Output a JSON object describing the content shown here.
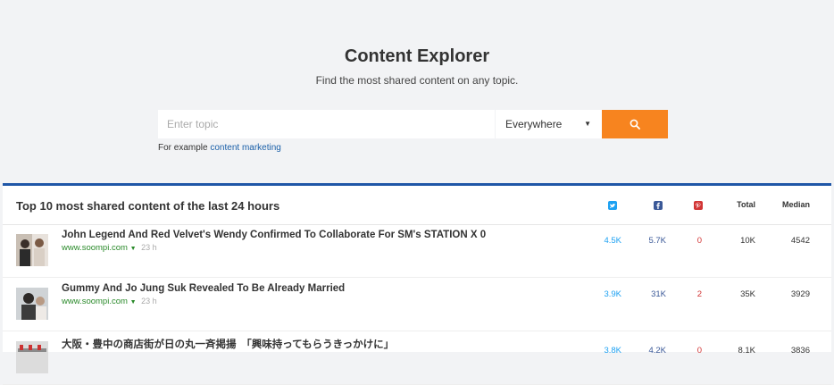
{
  "hero": {
    "title": "Content Explorer",
    "subtitle": "Find the most shared content on any topic.",
    "search_placeholder": "Enter topic",
    "scope_selected": "Everywhere",
    "example_prefix": "For example",
    "example_link": "content marketing"
  },
  "panel": {
    "title": "Top 10 most shared content of the last 24 hours",
    "columns": {
      "total": "Total",
      "median": "Median"
    },
    "rows": [
      {
        "title": "John Legend And Red Velvet's Wendy Confirmed To Collaborate For SM's STATION X 0",
        "domain": "www.soompi.com",
        "time": "23 h",
        "twitter": "4.5K",
        "facebook": "5.7K",
        "pinterest": "0",
        "total": "10K",
        "median": "4542"
      },
      {
        "title": "Gummy And Jo Jung Suk Revealed To Be Already Married",
        "domain": "www.soompi.com",
        "time": "23 h",
        "twitter": "3.9K",
        "facebook": "31K",
        "pinterest": "2",
        "total": "35K",
        "median": "3929"
      },
      {
        "title": "大阪・豊中の商店街が日の丸一斉掲揚　「興味持ってもらうきっかけに」",
        "domain": "",
        "time": "",
        "twitter": "3.8K",
        "facebook": "4.2K",
        "pinterest": "0",
        "total": "8.1K",
        "median": "3836"
      }
    ]
  },
  "colors": {
    "accent_orange": "#f7841f",
    "panel_border": "#1f56a7",
    "twitter": "#1da1f2",
    "facebook": "#3b5998",
    "pinterest": "#d23535",
    "domain_green": "#2a8a2a"
  }
}
